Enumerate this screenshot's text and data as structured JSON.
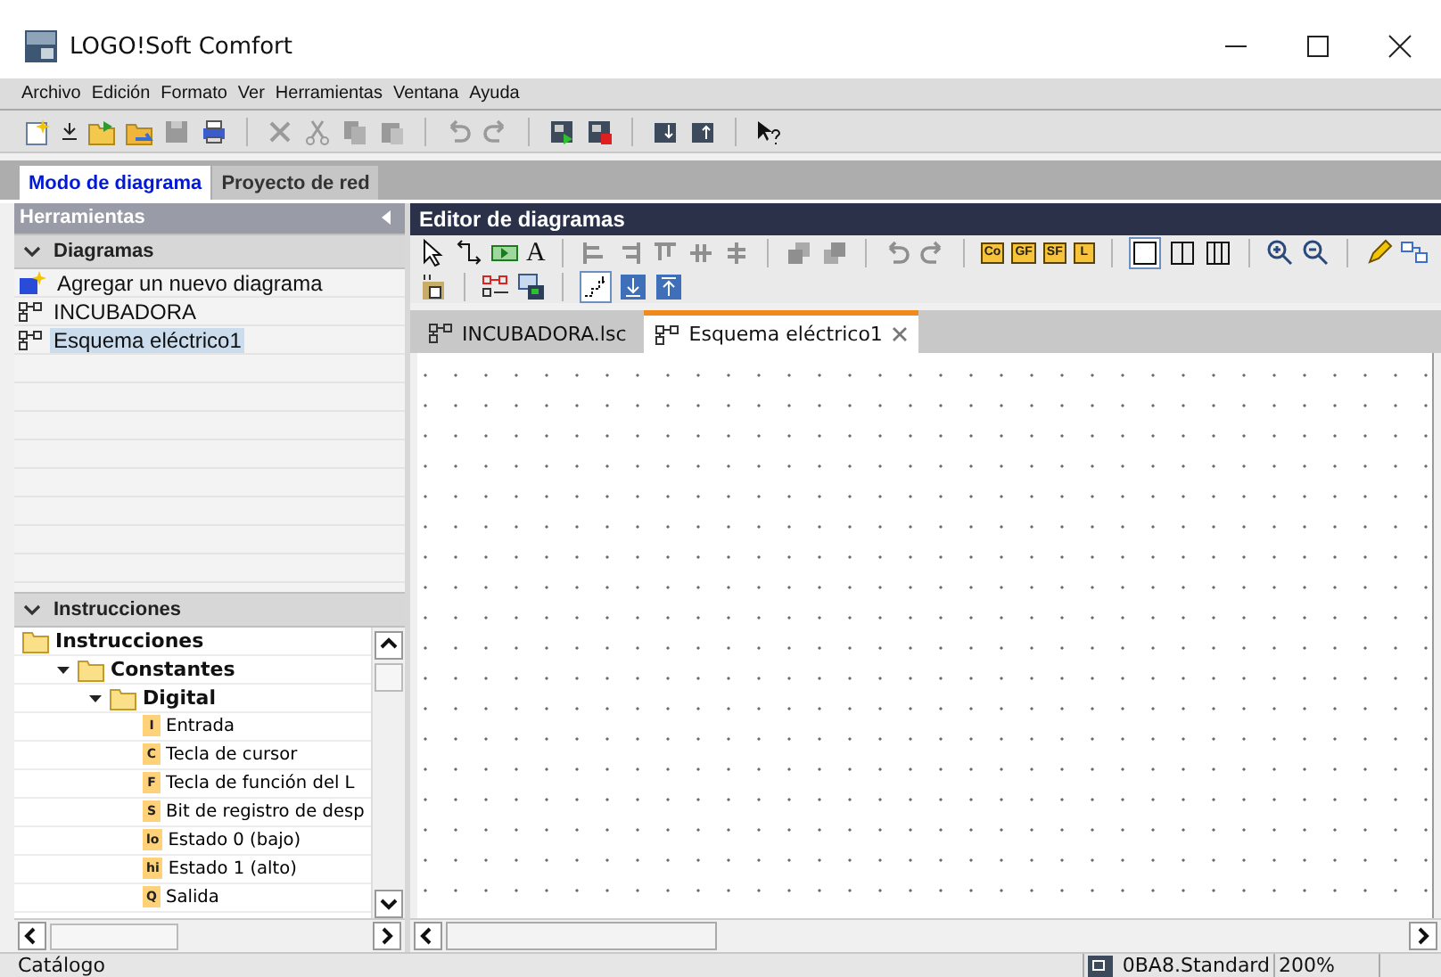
{
  "window": {
    "title": "LOGO!Soft Comfort"
  },
  "menu": [
    "Archivo",
    "Edición",
    "Formato",
    "Ver",
    "Herramientas",
    "Ventana",
    "Ayuda"
  ],
  "mode_tabs": [
    {
      "label": "Modo de diagrama",
      "selected": true
    },
    {
      "label": "Proyecto de red",
      "selected": false
    }
  ],
  "tools_panel": {
    "title": "Herramientas",
    "diagrams": {
      "title": "Diagramas",
      "expanded": true,
      "items": [
        {
          "kind": "add",
          "label": "Agregar un nuevo diagrama",
          "selected": false
        },
        {
          "kind": "diagram",
          "label": "INCUBADORA",
          "selected": false
        },
        {
          "kind": "diagram",
          "label": "Esquema eléctrico1",
          "selected": true
        }
      ]
    },
    "instructions": {
      "title": "Instrucciones",
      "expanded": true,
      "tree": [
        {
          "label": "Instrucciones",
          "children": [
            {
              "label": "Constantes",
              "expanded": true,
              "children": [
                {
                  "label": "Digital",
                  "expanded": true,
                  "children": [
                    {
                      "badge": "I",
                      "label": "Entrada"
                    },
                    {
                      "badge": "C",
                      "label": "Tecla de cursor"
                    },
                    {
                      "badge": "F",
                      "label": "Tecla de función del L"
                    },
                    {
                      "badge": "S",
                      "label": "Bit de registro de desp"
                    },
                    {
                      "badge": "lo",
                      "label": "Estado 0 (bajo)"
                    },
                    {
                      "badge": "hi",
                      "label": "Estado 1 (alto)"
                    },
                    {
                      "badge": "Q",
                      "label": "Salida"
                    }
                  ]
                }
              ]
            }
          ]
        }
      ]
    }
  },
  "editor": {
    "title": "Editor de diagramas",
    "text_tool": "A",
    "block_buttons": [
      "Co",
      "GF",
      "SF",
      "L"
    ],
    "tabs": [
      {
        "label": "INCUBADORA.lsc",
        "selected": false,
        "closable": false
      },
      {
        "label": "Esquema eléctrico1",
        "selected": true,
        "closable": true
      }
    ]
  },
  "status_bar": {
    "left": "Catálogo",
    "device": "0BA8.Standard",
    "zoom": "200%"
  }
}
